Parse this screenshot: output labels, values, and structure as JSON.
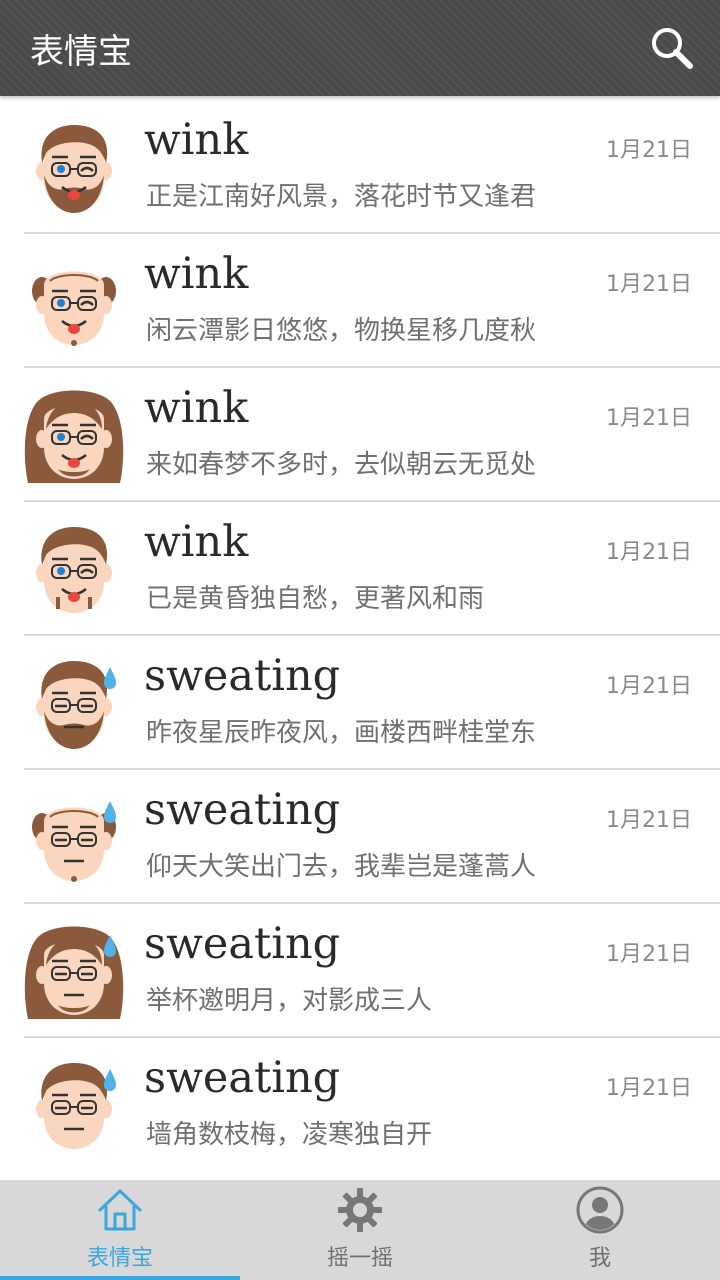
{
  "header": {
    "title": "表情宝",
    "search_icon": "search-icon"
  },
  "items": [
    {
      "title": "wink",
      "date": "1月21日",
      "subtitle": "正是江南好风景，落花时节又逢君",
      "avatar": {
        "type": "beard",
        "expression": "wink"
      }
    },
    {
      "title": "wink",
      "date": "1月21日",
      "subtitle": "闲云潭影日悠悠，物换星移几度秋",
      "avatar": {
        "type": "bald",
        "expression": "wink"
      }
    },
    {
      "title": "wink",
      "date": "1月21日",
      "subtitle": "来如春梦不多时，去似朝云无觅处",
      "avatar": {
        "type": "curly",
        "expression": "wink"
      }
    },
    {
      "title": "wink",
      "date": "1月21日",
      "subtitle": "已是黄昏独自愁，更著风和雨",
      "avatar": {
        "type": "glasses",
        "expression": "wink"
      }
    },
    {
      "title": "sweating",
      "date": "1月21日",
      "subtitle": "昨夜星辰昨夜风，画楼西畔桂堂东",
      "avatar": {
        "type": "beard",
        "expression": "sweating"
      }
    },
    {
      "title": "sweating",
      "date": "1月21日",
      "subtitle": "仰天大笑出门去，我辈岂是蓬蒿人",
      "avatar": {
        "type": "bald",
        "expression": "sweating"
      }
    },
    {
      "title": "sweating",
      "date": "1月21日",
      "subtitle": "举杯邀明月，对影成三人",
      "avatar": {
        "type": "curly",
        "expression": "sweating"
      }
    },
    {
      "title": "sweating",
      "date": "1月21日",
      "subtitle": "墙角数枝梅，凌寒独自开",
      "avatar": {
        "type": "glasses",
        "expression": "sweating"
      }
    }
  ],
  "tabs": [
    {
      "label": "表情宝",
      "icon": "home-icon",
      "active": true
    },
    {
      "label": "摇一摇",
      "icon": "gear-icon",
      "active": false
    },
    {
      "label": "我",
      "icon": "user-icon",
      "active": false
    }
  ],
  "colors": {
    "accent": "#3ba6dd",
    "header": "#4a4a4a",
    "tabbar": "#d8d8d8"
  }
}
